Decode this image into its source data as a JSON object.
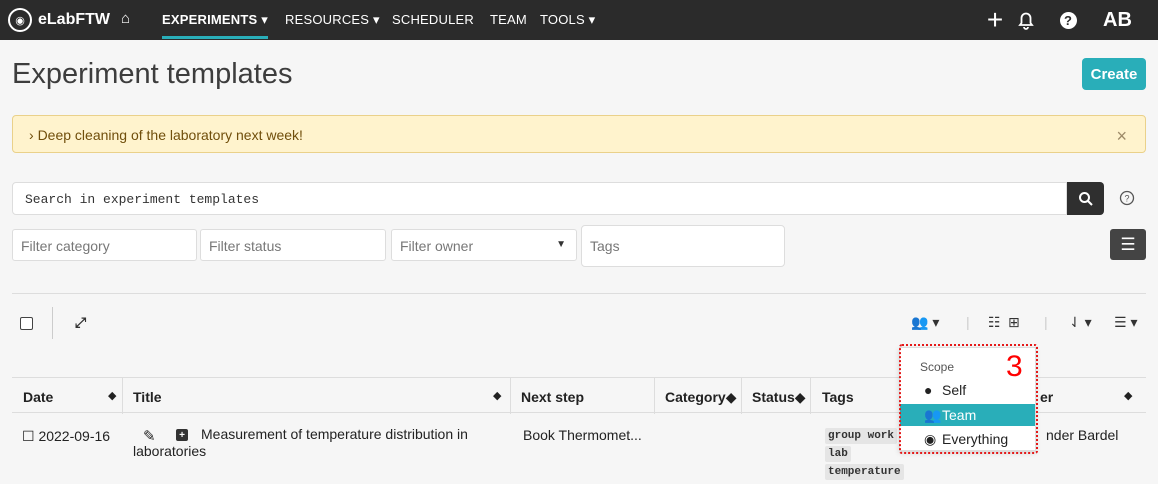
{
  "app": {
    "brand": "eLabFTW",
    "nav": [
      {
        "label": "EXPERIMENTS",
        "has_caret": true,
        "active": true
      },
      {
        "label": "RESOURCES",
        "has_caret": true
      },
      {
        "label": "SCHEDULER"
      },
      {
        "label": "TEAM"
      },
      {
        "label": "TOOLS",
        "has_caret": true
      }
    ],
    "user": "AB",
    "icons": [
      "home-icon",
      "plus-icon",
      "bell-icon",
      "help-icon"
    ],
    "accent_color": "#29aeb9"
  },
  "page": {
    "title": "Experiment templates",
    "create_label": "Create",
    "notice": "Deep cleaning of the laboratory next week!",
    "search_placeholder": "Search in experiment templates"
  },
  "filters": {
    "category": "Filter category",
    "status": "Filter status",
    "owner": "Filter owner",
    "tags": "Tags"
  },
  "table": {
    "headers": [
      "Date",
      "Title",
      "Next step",
      "Category",
      "Status",
      "Tags",
      "er"
    ],
    "rows": [
      {
        "date": "2022-09-16",
        "title": "Measurement of temperature distribution in laboratories",
        "next_step": "Book Thermomet...",
        "tags": [
          "group work",
          "lab",
          "temperature"
        ],
        "owner": "nder Bardel"
      }
    ]
  },
  "scope_menu": {
    "title": "Scope",
    "items": [
      {
        "label": "Self",
        "icon": "user-icon"
      },
      {
        "label": "Team",
        "icon": "team-icon",
        "selected": true
      },
      {
        "label": "Everything",
        "icon": "globe-icon"
      }
    ],
    "callout": "3"
  }
}
